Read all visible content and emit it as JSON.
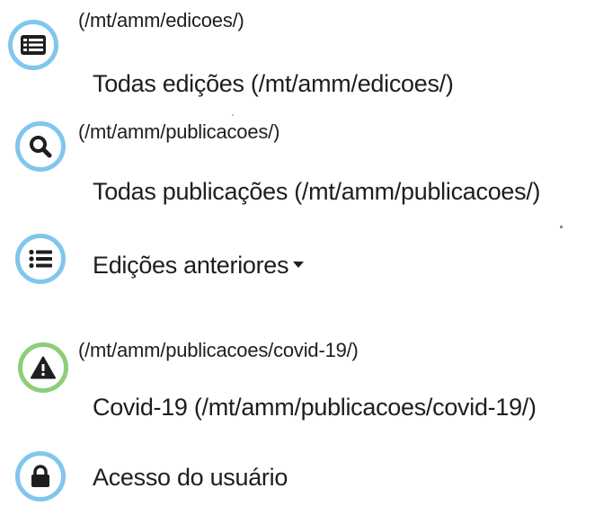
{
  "menu": {
    "items": [
      {
        "icon": "list-alt-icon",
        "url": "(/mt/amm/edicoes/)",
        "label": "Todas edições (/mt/amm/edicoes/)"
      },
      {
        "icon": "search-icon",
        "url": "(/mt/amm/publicacoes/)",
        "label": "Todas publicações (/mt/amm/publicacoes/)"
      },
      {
        "icon": "list-icon",
        "label": "Edições anteriores"
      },
      {
        "icon": "warning-icon",
        "url": "(/mt/amm/publicacoes/covid-19/)",
        "label": "Covid-19 (/mt/amm/publicacoes/covid-19/)"
      },
      {
        "icon": "lock-icon",
        "label": "Acesso do usuário"
      }
    ]
  },
  "colors": {
    "circle_blue": "#80c6ee",
    "circle_green": "#8cce79",
    "text": "#1e1e1e"
  }
}
